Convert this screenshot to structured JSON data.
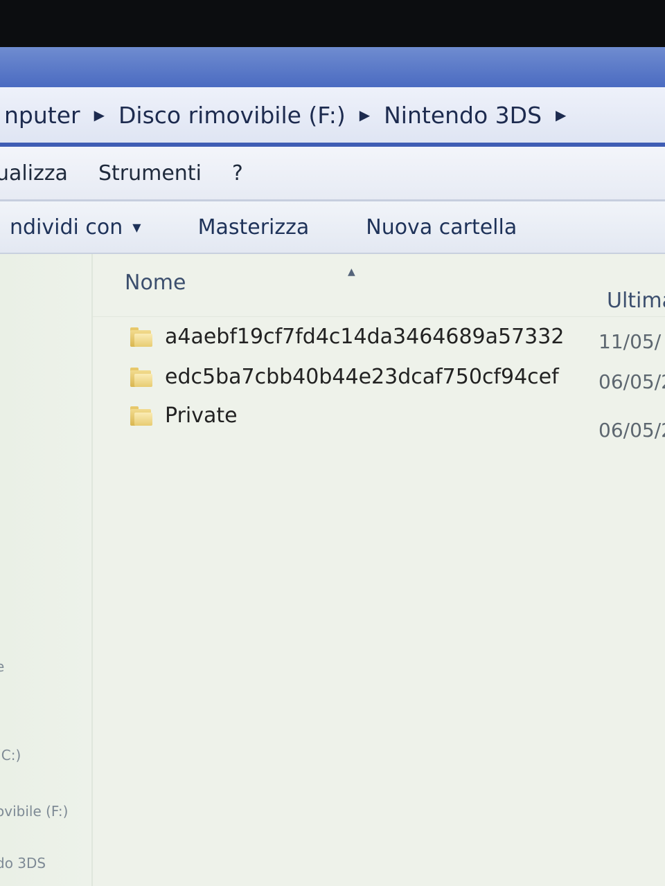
{
  "address": {
    "crumbs": [
      "nputer",
      "Disco rimovibile (F:)",
      "Nintendo 3DS"
    ]
  },
  "menu": {
    "items": [
      "ualizza",
      "Strumenti",
      "?"
    ]
  },
  "toolbar": {
    "share_label": "ndividi con",
    "burn_label": "Masterizza",
    "new_folder_label": "Nuova cartella"
  },
  "columns": {
    "name": "Nome",
    "modified": "Ultima"
  },
  "files": [
    {
      "name": "a4aebf19cf7fd4c14da3464689a57332",
      "modified": "11/05/"
    },
    {
      "name": "edc5ba7cbb40b44e23dcaf750cf94cef",
      "modified": "06/05/2"
    },
    {
      "name": "Private",
      "modified": "06/05/2"
    }
  ],
  "sidebar": {
    "items": [
      "e",
      "(C:)",
      "ovibile (F:)",
      "do 3DS"
    ]
  },
  "colors": {
    "title_bar": "#4b6bc1",
    "window_bg": "#edf1ea",
    "folder": "#e8cc72"
  }
}
